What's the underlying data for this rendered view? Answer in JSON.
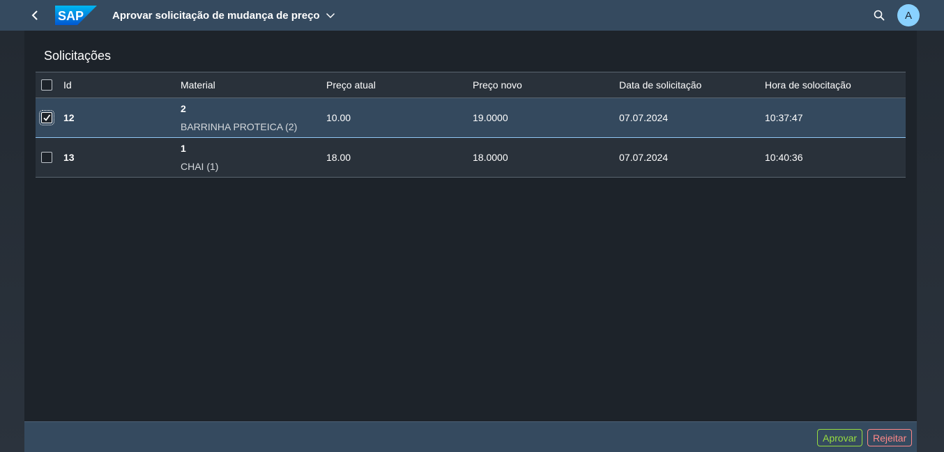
{
  "shell": {
    "logo_text": "SAP",
    "title": "Aprovar solicitação de mudança de preço",
    "avatar_initial": "A",
    "icons": [
      "back-arrow-icon",
      "chevron-down-icon",
      "search-icon"
    ]
  },
  "section": {
    "title": "Solicitações"
  },
  "table": {
    "headers": {
      "id": "Id",
      "material": "Material",
      "preco_atual": "Preço atual",
      "preco_novo": "Preço novo",
      "data": "Data de solicitação",
      "hora": "Hora de solocitação"
    },
    "rows": [
      {
        "selected": true,
        "id": "12",
        "material_code": "2",
        "material_name": "BARRINHA PROTEICA (2)",
        "preco_atual": "10.00",
        "preco_novo": "19.0000",
        "data": "07.07.2024",
        "hora": "10:37:47"
      },
      {
        "selected": false,
        "id": "13",
        "material_code": "1",
        "material_name": "CHAI (1)",
        "preco_atual": "18.00",
        "preco_novo": "18.0000",
        "data": "07.07.2024",
        "hora": "10:40:36"
      }
    ]
  },
  "footer": {
    "approve_label": "Aprovar",
    "reject_label": "Rejeitar"
  },
  "colors": {
    "shell": "#354a5f",
    "accent": "#89d1ff",
    "approve": "#97dd40",
    "reject": "#ff8888"
  }
}
